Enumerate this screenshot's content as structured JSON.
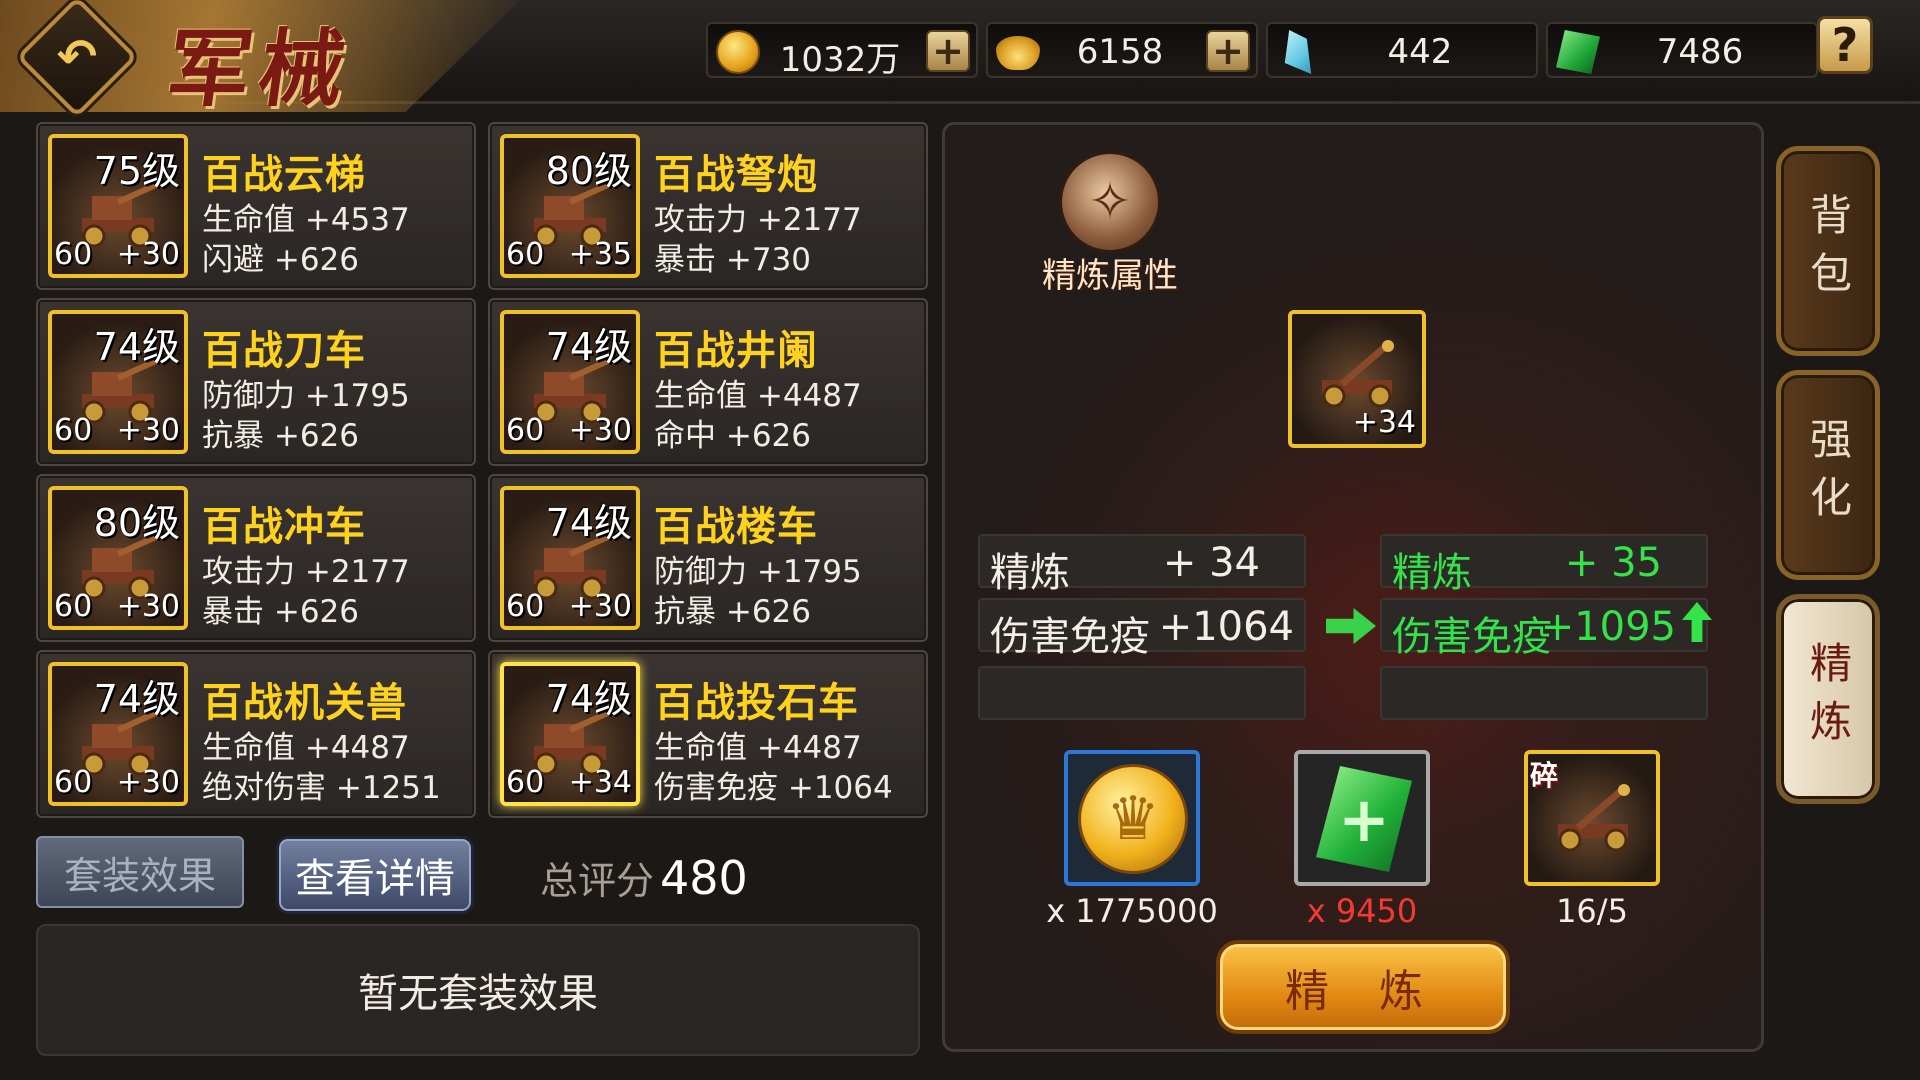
{
  "header": {
    "title": "军械",
    "currencies": [
      {
        "icon": "gold-coin-icon",
        "value": "1032万",
        "addable": true
      },
      {
        "icon": "gold-ingot-icon",
        "value": "6158",
        "addable": true
      },
      {
        "icon": "crystal-icon",
        "value": "442",
        "addable": false
      },
      {
        "icon": "jade-icon",
        "value": "7486",
        "addable": false
      }
    ],
    "help_label": "?"
  },
  "items": [
    {
      "level": "75级",
      "star": "60",
      "plus": "+30",
      "name": "百战云梯",
      "stat1": "生命值 +4537",
      "stat2": "闪避 +626"
    },
    {
      "level": "80级",
      "star": "60",
      "plus": "+35",
      "name": "百战弩炮",
      "stat1": "攻击力 +2177",
      "stat2": "暴击 +730"
    },
    {
      "level": "74级",
      "star": "60",
      "plus": "+30",
      "name": "百战刀车",
      "stat1": "防御力 +1795",
      "stat2": "抗暴 +626"
    },
    {
      "level": "74级",
      "star": "60",
      "plus": "+30",
      "name": "百战井阑",
      "stat1": "生命值 +4487",
      "stat2": "命中 +626"
    },
    {
      "level": "80级",
      "star": "60",
      "plus": "+30",
      "name": "百战冲车",
      "stat1": "攻击力 +2177",
      "stat2": "暴击 +626"
    },
    {
      "level": "74级",
      "star": "60",
      "plus": "+30",
      "name": "百战楼车",
      "stat1": "防御力 +1795",
      "stat2": "抗暴 +626"
    },
    {
      "level": "74级",
      "star": "60",
      "plus": "+30",
      "name": "百战机关兽",
      "stat1": "生命值 +4487",
      "stat2": "绝对伤害 +1251"
    },
    {
      "level": "74级",
      "star": "60",
      "plus": "+34",
      "name": "百战投石车",
      "stat1": "生命值 +4487",
      "stat2": "伤害免疫 +1064",
      "selected": true
    }
  ],
  "bottom": {
    "set_effect_label": "套装效果",
    "detail_label": "查看详情",
    "score_label": "总评分",
    "score_value": "480",
    "set_panel_text": "暂无套装效果"
  },
  "refine": {
    "attr_label": "精炼属性",
    "item_plus": "+34",
    "current": {
      "refine_label": "精炼",
      "refine_value": "+ 34",
      "stat_label": "伤害免疫",
      "stat_value": "+1064"
    },
    "next": {
      "refine_label": "精炼",
      "refine_value": "+ 35",
      "stat_label": "伤害免疫",
      "stat_value": "+1095"
    },
    "costs": {
      "coin": "x 1775000",
      "jade": "x 9450",
      "fragment_mark": "碎",
      "fragment": "16/5"
    },
    "button_label": "精 炼"
  },
  "side_tabs": [
    {
      "label": "背包",
      "active": false
    },
    {
      "label": "强化",
      "active": false
    },
    {
      "label": "精炼",
      "active": true
    }
  ],
  "colors": {
    "item_name": "#ffd21e",
    "upgrade_green": "#34e24a",
    "cost_insufficient": "#f43a30",
    "thumb_border": "#f0c22a"
  }
}
